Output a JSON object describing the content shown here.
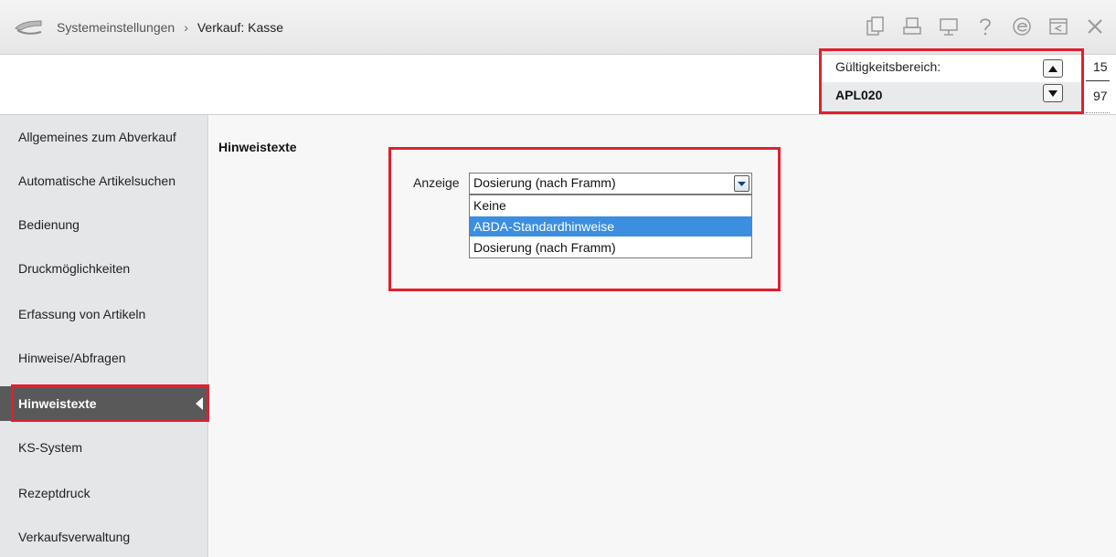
{
  "breadcrumb": {
    "root": "Systemeinstellungen",
    "separator": "›",
    "current": "Verkauf: Kasse"
  },
  "toolbar_icons": [
    "copy-icon",
    "print-icon",
    "monitor-icon",
    "help-icon",
    "edge-icon",
    "window-icon",
    "close-icon"
  ],
  "scope": {
    "label": "Gültigkeitsbereich:",
    "value": "APL020",
    "page_top": "15",
    "page_bottom": "97"
  },
  "sidebar": {
    "items": [
      {
        "label": "Allgemeines zum Abverkauf"
      },
      {
        "label": "Automatische Artikelsuchen"
      },
      {
        "label": "Bedienung"
      },
      {
        "label": "Druckmöglichkeiten"
      },
      {
        "label": "Erfassung von Artikeln"
      },
      {
        "label": "Hinweise/Abfragen"
      },
      {
        "label": "Hinweistexte",
        "active": true
      },
      {
        "label": "KS-System"
      },
      {
        "label": "Rezeptdruck"
      },
      {
        "label": "Verkaufsverwaltung"
      }
    ]
  },
  "main": {
    "section_title": "Hinweistexte",
    "anzeige_label": "Anzeige",
    "select_value": "Dosierung (nach Framm)",
    "options": [
      "Keine",
      "ABDA-Standardhinweise",
      "Dosierung (nach Framm)"
    ],
    "highlighted_option": "ABDA-Standardhinweise"
  },
  "colors": {
    "highlight_red": "#e0202e",
    "active_item": "#595959",
    "selection_blue": "#3c8ee0"
  }
}
